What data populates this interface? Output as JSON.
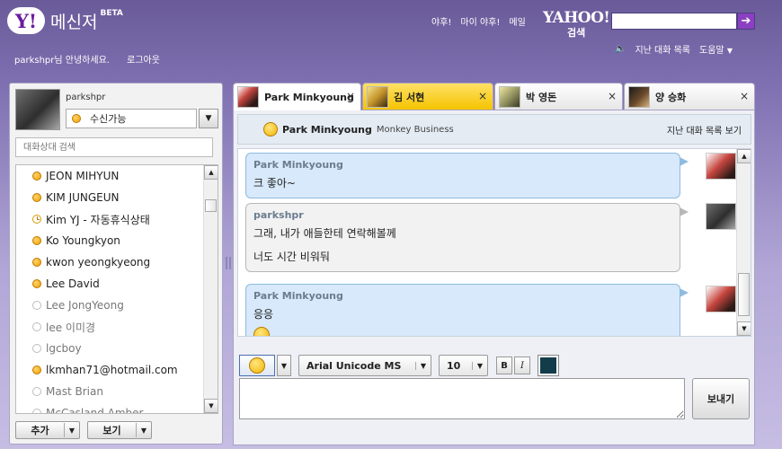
{
  "app": {
    "logo_text": "Y!",
    "title": "메신저",
    "beta": "BETA"
  },
  "top_links": [
    "야후!",
    "마이 야후!",
    "메일"
  ],
  "yahoo_search": {
    "brand": "YAHOO!",
    "label": "검색",
    "placeholder": "",
    "go_icon": "arrow-right-icon"
  },
  "utility_links": {
    "sound_icon": "speaker-icon",
    "history": "지난 대화 목록",
    "help": "도움말"
  },
  "greeting": {
    "text": "parkshpr님 안녕하세요.",
    "logout": "로그아웃"
  },
  "profile": {
    "name": "parkshpr",
    "status": "수신가능",
    "status_color": "#f0a000"
  },
  "contact_search": {
    "placeholder": "대화상대 검색"
  },
  "contacts": [
    {
      "name": "JEON MIHYUN",
      "status": "online"
    },
    {
      "name": "KIM JUNGEUN",
      "status": "online"
    },
    {
      "name": "Kim YJ - 자동휴식상태",
      "status": "away"
    },
    {
      "name": "Ko Youngkyon",
      "status": "online"
    },
    {
      "name": "kwon yeongkyeong",
      "status": "online"
    },
    {
      "name": "Lee David",
      "status": "online"
    },
    {
      "name": "Lee JongYeong",
      "status": "offline"
    },
    {
      "name": "lee 이미경",
      "status": "offline"
    },
    {
      "name": "lgcboy",
      "status": "offline"
    },
    {
      "name": "lkmhan71@hotmail.com",
      "status": "online"
    },
    {
      "name": "Mast Brian",
      "status": "offline"
    },
    {
      "name": "McCasland Amber",
      "status": "offline"
    }
  ],
  "left_buttons": {
    "add": "추가",
    "view": "보기"
  },
  "tabs": [
    {
      "label": "Park Minkyoung",
      "state": "active"
    },
    {
      "label": "김 서현",
      "state": "flash"
    },
    {
      "label": "박 영돈",
      "state": "normal"
    },
    {
      "label": "양 승화",
      "state": "normal"
    }
  ],
  "tab_close_icon": "×",
  "chat_header": {
    "name": "Park Minkyoung",
    "status_message": "Monkey Business",
    "history_link": "지난 대화 목록 보기"
  },
  "messages": [
    {
      "sender": "Park Minkyoung",
      "lines": [
        "크 좋아~"
      ],
      "mine": false
    },
    {
      "sender": "parkshpr",
      "lines": [
        "그래, 내가 애들한테 연락해볼께",
        "너도 시간 비워둬"
      ],
      "mine": true
    },
    {
      "sender": "Park Minkyoung",
      "lines": [
        "응응"
      ],
      "mine": false,
      "emoticon": "grin-icon"
    }
  ],
  "toolbar": {
    "emoticon_icon": "smiley-icon",
    "font": "Arial Unicode MS",
    "size": "10",
    "bold": "B",
    "italic": "I",
    "color": "#123c4a"
  },
  "compose": {
    "value": "",
    "send_label": "보내기"
  },
  "colors": {
    "accent_purple": "#6b1aa0",
    "online": "#f0a000",
    "bubble_in": "#d7e9fa",
    "bubble_out": "#f2f2f2",
    "tab_flash": "#f5c400"
  }
}
